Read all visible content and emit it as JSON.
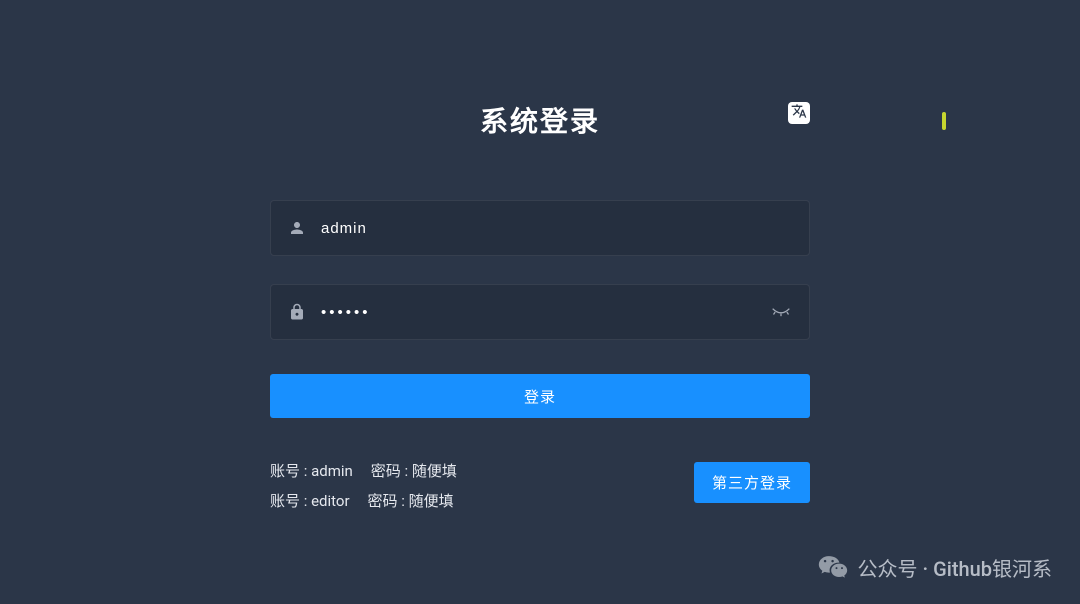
{
  "title": "系统登录",
  "username": {
    "value": "admin",
    "placeholder": "账号"
  },
  "password": {
    "value": "••••••",
    "placeholder": "密码"
  },
  "loginButton": "登录",
  "hints": {
    "line1": {
      "account": "账号 : admin",
      "password": "密码 : 随便填"
    },
    "line2": {
      "account": "账号 : editor",
      "password": "密码 : 随便填"
    }
  },
  "thirdPartyButton": "第三方登录",
  "watermark": "公众号 · Github银河系"
}
